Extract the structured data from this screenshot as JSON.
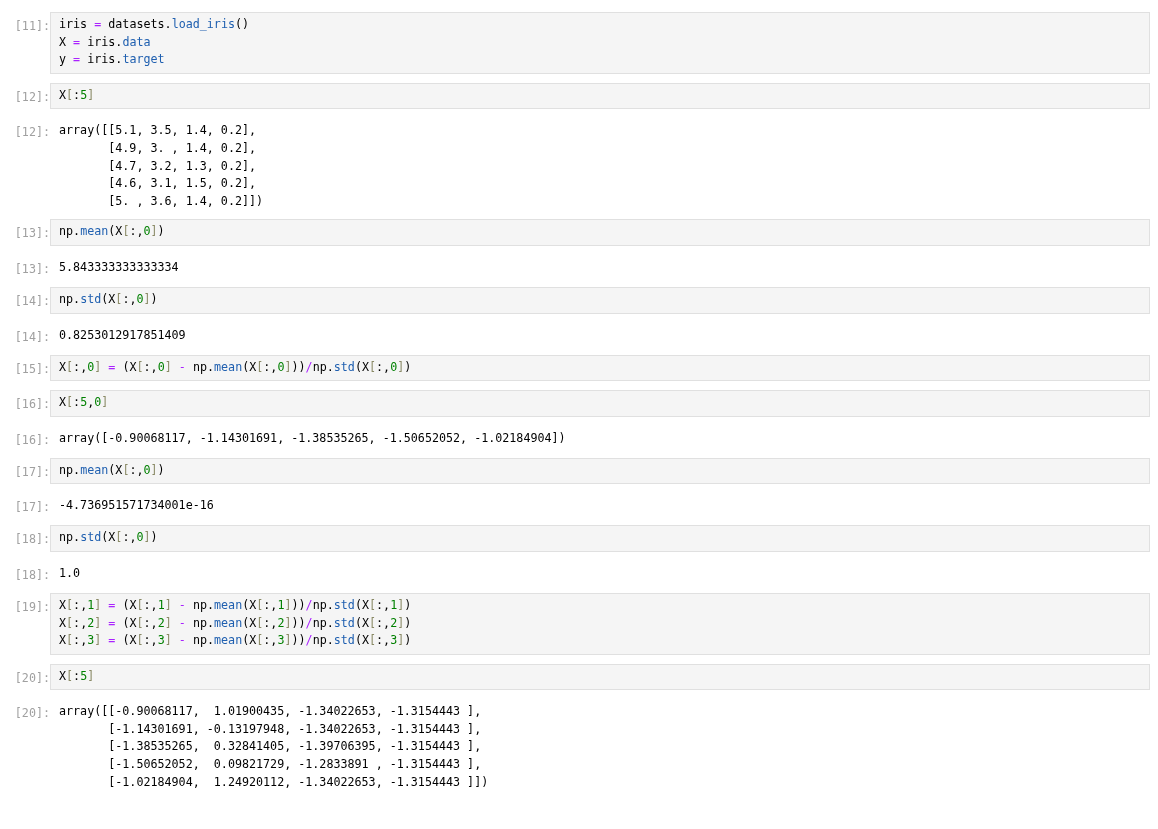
{
  "cells": [
    {
      "kind": "input",
      "prompt": "[11]:",
      "lines": [
        "iris = datasets.load_iris()",
        "X = iris.data",
        "y = iris.target"
      ]
    },
    {
      "kind": "input",
      "prompt": "[12]:",
      "lines": [
        "X[:5]"
      ]
    },
    {
      "kind": "output",
      "prompt": "[12]:",
      "lines": [
        "array([[5.1, 3.5, 1.4, 0.2],",
        "       [4.9, 3. , 1.4, 0.2],",
        "       [4.7, 3.2, 1.3, 0.2],",
        "       [4.6, 3.1, 1.5, 0.2],",
        "       [5. , 3.6, 1.4, 0.2]])"
      ]
    },
    {
      "kind": "input",
      "prompt": "[13]:",
      "lines": [
        "np.mean(X[:,0])"
      ]
    },
    {
      "kind": "output",
      "prompt": "[13]:",
      "lines": [
        "5.843333333333334"
      ]
    },
    {
      "kind": "input",
      "prompt": "[14]:",
      "lines": [
        "np.std(X[:,0])"
      ]
    },
    {
      "kind": "output",
      "prompt": "[14]:",
      "lines": [
        "0.8253012917851409"
      ]
    },
    {
      "kind": "input",
      "prompt": "[15]:",
      "lines": [
        "X[:,0] = (X[:,0] - np.mean(X[:,0]))/np.std(X[:,0])"
      ]
    },
    {
      "kind": "input",
      "prompt": "[16]:",
      "lines": [
        "X[:5,0]"
      ]
    },
    {
      "kind": "output",
      "prompt": "[16]:",
      "lines": [
        "array([-0.90068117, -1.14301691, -1.38535265, -1.50652052, -1.02184904])"
      ]
    },
    {
      "kind": "input",
      "prompt": "[17]:",
      "lines": [
        "np.mean(X[:,0])"
      ]
    },
    {
      "kind": "output",
      "prompt": "[17]:",
      "lines": [
        "-4.736951571734001e-16"
      ]
    },
    {
      "kind": "input",
      "prompt": "[18]:",
      "lines": [
        "np.std(X[:,0])"
      ]
    },
    {
      "kind": "output",
      "prompt": "[18]:",
      "lines": [
        "1.0"
      ]
    },
    {
      "kind": "input",
      "prompt": "[19]:",
      "lines": [
        "X[:,1] = (X[:,1] - np.mean(X[:,1]))/np.std(X[:,1])",
        "X[:,2] = (X[:,2] - np.mean(X[:,2]))/np.std(X[:,2])",
        "X[:,3] = (X[:,3] - np.mean(X[:,3]))/np.std(X[:,3])"
      ]
    },
    {
      "kind": "input",
      "prompt": "[20]:",
      "lines": [
        "X[:5]"
      ]
    },
    {
      "kind": "output",
      "prompt": "[20]:",
      "lines": [
        "array([[-0.90068117,  1.01900435, -1.34022653, -1.3154443 ],",
        "       [-1.14301691, -0.13197948, -1.34022653, -1.3154443 ],",
        "       [-1.38535265,  0.32841405, -1.39706395, -1.3154443 ],",
        "       [-1.50652052,  0.09821729, -1.2833891 , -1.3154443 ],",
        "       [-1.02184904,  1.24920112, -1.34022653, -1.3154443 ]])"
      ]
    }
  ]
}
